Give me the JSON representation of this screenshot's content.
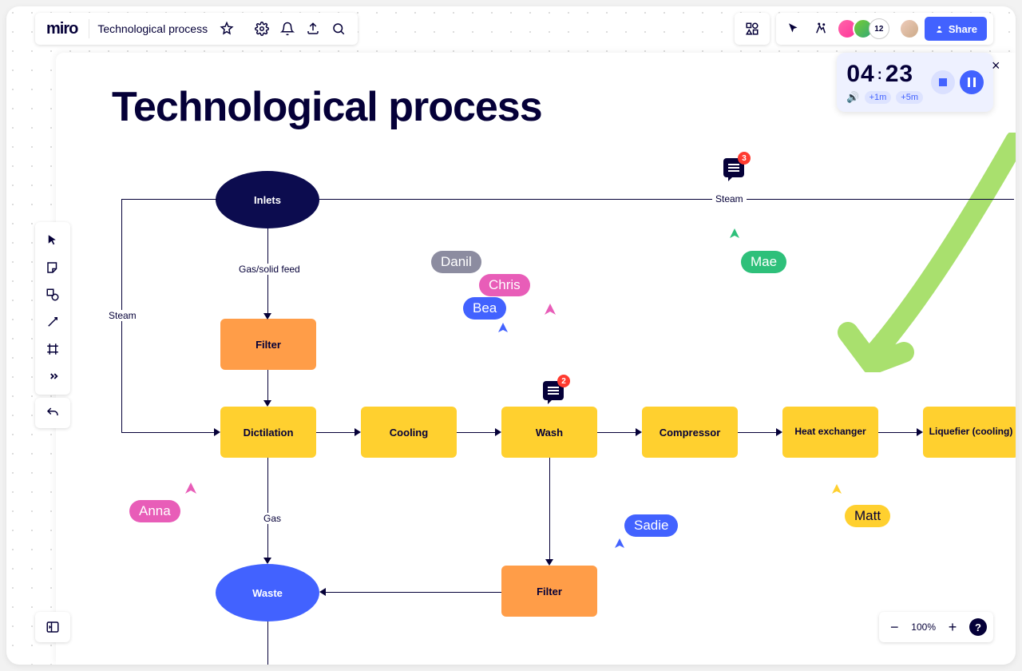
{
  "header": {
    "logo": "miro",
    "board_title": "Technological process",
    "avatar_count": "12",
    "share_label": "Share"
  },
  "timer": {
    "minutes": "04",
    "seconds": "23",
    "add1": "+1m",
    "add5": "+5m"
  },
  "zoom": {
    "value": "100%"
  },
  "canvas": {
    "title": "Technological process",
    "nodes": {
      "inlets": "Inlets",
      "filter1": "Filter",
      "dictilation": "Dictilation",
      "cooling": "Cooling",
      "wash": "Wash",
      "compressor": "Compressor",
      "heatex": "Heat exchanger",
      "liquefier": "Liquefier (cooling)",
      "filter2": "Filter",
      "waste": "Waste"
    },
    "edges": {
      "gas_solid": "Gas/solid feed",
      "steam_left": "Steam",
      "steam_right": "Steam",
      "gas": "Gas"
    },
    "comments": {
      "c1": "3",
      "c2": "2"
    },
    "cursors": {
      "danil": "Danil",
      "chris": "Chris",
      "bea": "Bea",
      "anna": "Anna",
      "mae": "Mae",
      "sadie": "Sadie",
      "matt": "Matt"
    }
  }
}
